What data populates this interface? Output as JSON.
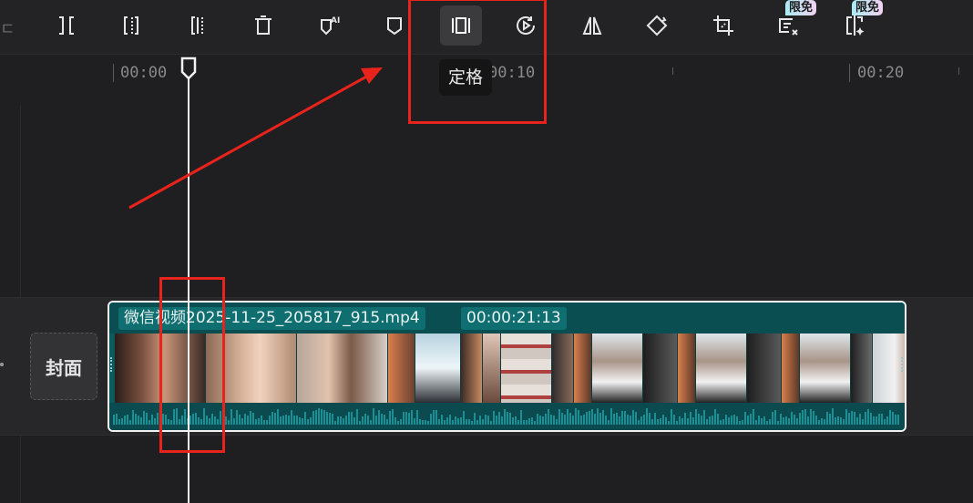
{
  "toolbar": {
    "tools": [
      {
        "name": "split-icon"
      },
      {
        "name": "trim-left-icon"
      },
      {
        "name": "trim-right-icon"
      },
      {
        "name": "delete-icon"
      },
      {
        "name": "ai-marker-icon",
        "label": "AI"
      },
      {
        "name": "marker-icon"
      },
      {
        "name": "freeze-frame-icon",
        "active": true
      },
      {
        "name": "reverse-icon"
      },
      {
        "name": "mirror-icon"
      },
      {
        "name": "rotate-icon"
      },
      {
        "name": "crop-icon"
      },
      {
        "name": "remove-subtitle-icon",
        "badge": "限免"
      },
      {
        "name": "smart-crop-icon",
        "badge": "限免"
      }
    ],
    "edge_glyph": "ㄷ"
  },
  "tooltip": {
    "text": "定格"
  },
  "ruler": {
    "labels": [
      "00:00",
      "00:10",
      "00:20"
    ]
  },
  "track": {
    "cover_label": "封面"
  },
  "clip": {
    "filename": "微信视频2025-11-25_205817_915.mp4",
    "duration": "00:00:21:13"
  },
  "colors": {
    "accent_annotation": "#e8231b",
    "clip_teal": "#0a5a5e",
    "badge_gradient_start": "#a9ecf3",
    "badge_gradient_end": "#f1d2f2"
  }
}
